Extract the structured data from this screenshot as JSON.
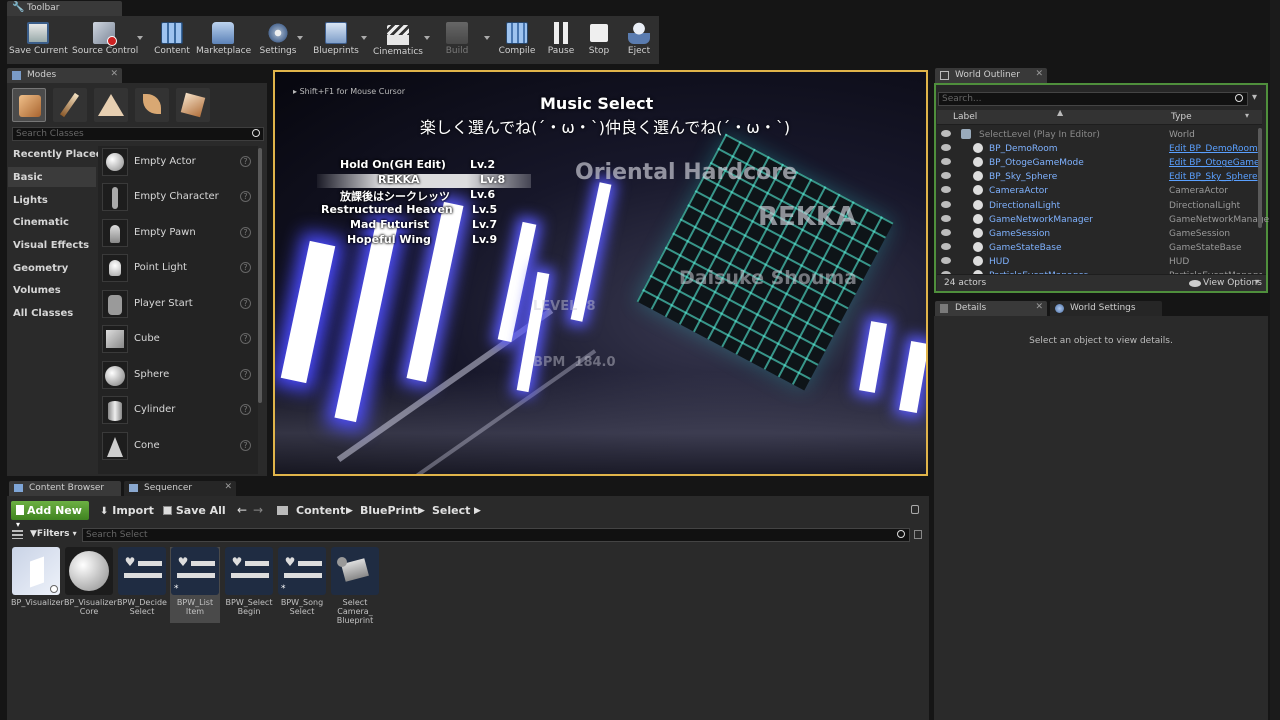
{
  "toolbar_tab": {
    "label": "Toolbar"
  },
  "toolbar": {
    "buttons": [
      {
        "label": "Save Current",
        "icon": "save-icon"
      },
      {
        "label": "Source Control",
        "icon": "source-control-icon"
      },
      {
        "label": "Content",
        "icon": "content-icon"
      },
      {
        "label": "Marketplace",
        "icon": "marketplace-icon"
      },
      {
        "label": "Settings",
        "icon": "settings-icon"
      },
      {
        "label": "Blueprints",
        "icon": "blueprints-icon"
      },
      {
        "label": "Cinematics",
        "icon": "cinematics-icon"
      },
      {
        "label": "Build",
        "icon": "build-icon"
      },
      {
        "label": "Compile",
        "icon": "compile-icon"
      },
      {
        "label": "Pause",
        "icon": "pause-icon"
      },
      {
        "label": "Stop",
        "icon": "stop-icon"
      },
      {
        "label": "Eject",
        "icon": "eject-icon"
      }
    ]
  },
  "modes": {
    "tab": "Modes",
    "search_placeholder": "Search Classes",
    "categories": [
      "Recently Placed",
      "Basic",
      "Lights",
      "Cinematic",
      "Visual Effects",
      "Geometry",
      "Volumes",
      "All Classes"
    ],
    "selected_category": "Basic",
    "items": [
      "Empty Actor",
      "Empty Character",
      "Empty Pawn",
      "Point Light",
      "Player Start",
      "Cube",
      "Sphere",
      "Cylinder",
      "Cone"
    ]
  },
  "viewport": {
    "hint": "Shift+F1 for Mouse Cursor",
    "title": "Music Select",
    "subtitle": "楽しく選んでね(´・ω・`)仲良く選んでね(´・ω・`)",
    "songs": [
      {
        "name": "Hold On(GH Edit)",
        "level": "Lv.2"
      },
      {
        "name": "REKKA",
        "level": "Lv.8"
      },
      {
        "name": "放課後はシークレッツ",
        "level": "Lv.6"
      },
      {
        "name": "Restructured Heaven",
        "level": "Lv.5"
      },
      {
        "name": "Mad Futurist",
        "level": "Lv.7"
      },
      {
        "name": "Hopeful Wing",
        "level": "Lv.9"
      }
    ],
    "genre": "Oriental Hardcore",
    "song_title": "REKKA",
    "artist": "Daisuke Shouma",
    "level_label": "LEVEL  8",
    "bpm_label": "BPM  184.0"
  },
  "outliner": {
    "tab": "World Outliner",
    "search_placeholder": "Search...",
    "col_label": "Label",
    "col_type": "Type",
    "rows": [
      {
        "name": "SelectLevel (Play In Editor)",
        "type": "World"
      },
      {
        "name": "BP_DemoRoom",
        "type": "Edit BP_DemoRoom"
      },
      {
        "name": "BP_OtogeGameMode",
        "type": "Edit BP_OtogeGame"
      },
      {
        "name": "BP_Sky_Sphere",
        "type": "Edit BP_Sky_Sphere"
      },
      {
        "name": "CameraActor",
        "type": "CameraActor"
      },
      {
        "name": "DirectionalLight",
        "type": "DirectionalLight"
      },
      {
        "name": "GameNetworkManager",
        "type": "GameNetworkManage"
      },
      {
        "name": "GameSession",
        "type": "GameSession"
      },
      {
        "name": "GameStateBase",
        "type": "GameStateBase"
      },
      {
        "name": "HUD",
        "type": "HUD"
      },
      {
        "name": "ParticleEventManager",
        "type": "ParticleEventManager"
      }
    ],
    "count": "24 actors",
    "view_options": "View Options"
  },
  "details": {
    "tab": "Details",
    "tab2": "World Settings",
    "empty": "Select an object to view details."
  },
  "content_browser": {
    "tab": "Content Browser",
    "tab2": "Sequencer",
    "add_new": "Add New",
    "import": "Import",
    "save_all": "Save All",
    "path": [
      "Content",
      "BluePrint",
      "Select"
    ],
    "filters": "Filters",
    "search_placeholder": "Search Select",
    "assets": [
      "BP_Visualizer",
      "BP_Visualizer Core",
      "BPW_Decide Select",
      "BPW_List Item",
      "BPW_Select Begin",
      "BPW_Song Select",
      "Select Camera_ Blueprint"
    ]
  }
}
